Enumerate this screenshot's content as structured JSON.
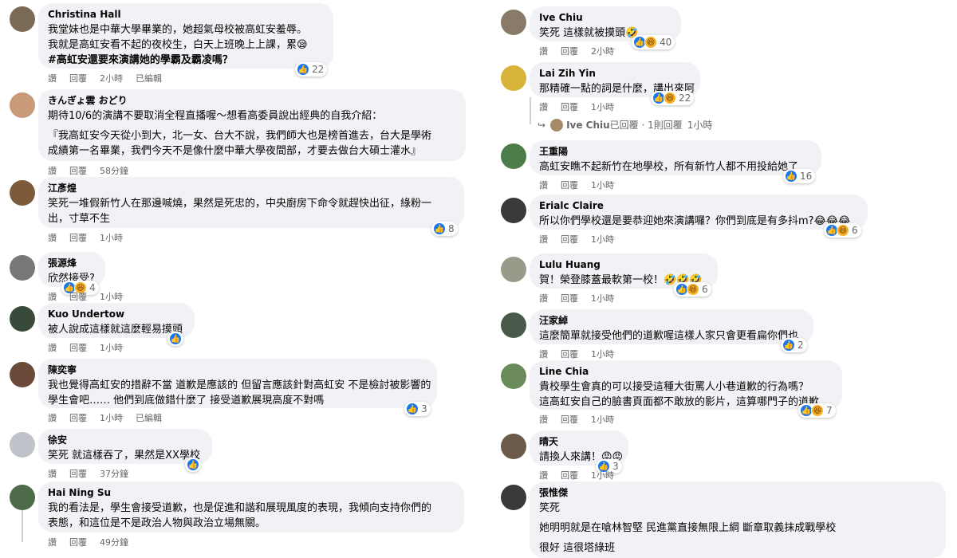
{
  "actions": {
    "like": "讚",
    "reply": "回覆",
    "edited": "已編輯"
  },
  "colors": {
    "bubble": "#f0f2f5",
    "meta_text": "#65676b",
    "like_blue": "#1877f2",
    "haha_yellow": "#f7b125"
  },
  "left": [
    {
      "author": "Christina Hall",
      "lines": [
        "我堂妹也是中華大學畢業的，她超氣母校被高虹安羞辱。",
        "我就是高虹安看不起的夜校生，白天上班晚上上課，累😪",
        "#高虹安還要來演講她的學霸及霸凌嗎？"
      ],
      "time": "2小時",
      "edited": true,
      "reactions": [
        "like"
      ],
      "count": "22"
    },
    {
      "author": "きんぎょ雲 おどり",
      "lines": [
        "期待10/6的演講不要取消全程直播喔～想看高委員說出經典的自我介紹：",
        "『我高虹安今天從小到大，北一女、台大不說，我們師大也是榜首進去，台大是學術",
        "成績第一名畢業，我們今天不是像什麼中華大學夜間部，才要去做台大碩士灌水』"
      ],
      "time": "58分鐘",
      "edited": false,
      "reactions": [],
      "count": ""
    },
    {
      "author": "江彥煌",
      "lines": [
        "笑死一堆假新竹人在那邊喊燒，果然是死忠的，中央廚房下命令就趕快出征，綠粉一",
        "出，寸草不生"
      ],
      "time": "1小時",
      "edited": false,
      "reactions": [
        "like"
      ],
      "count": "8"
    },
    {
      "author": "張源烽",
      "lines": [
        "欣然接受?"
      ],
      "time": "1小時",
      "edited": false,
      "reactions": [
        "like",
        "haha"
      ],
      "count": "4"
    },
    {
      "author": "Kuo Undertow",
      "lines": [
        "被人說成這樣就這麼輕易摸頭"
      ],
      "time": "1小時",
      "edited": false,
      "reactions": [
        "like"
      ],
      "count": ""
    },
    {
      "author": "陳奕寧",
      "lines": [
        "我也覺得高虹安的措辭不當 道歉是應該的 但留言應該針對高虹安 不是檢討被影響的",
        "學生會吧…… 他們到底做錯什麼了 接受道歉展現高度不對嗎"
      ],
      "time": "1小時",
      "edited": true,
      "reactions": [
        "like"
      ],
      "count": "3"
    },
    {
      "author": "徐安",
      "lines": [
        "笑死 就這樣吞了，果然是XX學校"
      ],
      "time": "37分鐘",
      "edited": false,
      "reactions": [
        "like"
      ],
      "count": ""
    },
    {
      "author": "Hai Ning Su",
      "lines": [
        "我的看法是，學生會接受道歉，也是促進和諧和展現風度的表現，我傾向支持你們的",
        "表態，和這位是不是政治人物與政治立場無關。"
      ],
      "time": "49分鐘",
      "edited": false,
      "reactions": [],
      "count": ""
    }
  ],
  "right": [
    {
      "author": "Ive Chiu",
      "lines": [
        "笑死 這樣就被摸頭🤣"
      ],
      "time": "2小時",
      "edited": false,
      "reactions": [
        "like",
        "haha"
      ],
      "count": "40"
    },
    {
      "author": "Lai Zih Yin",
      "lines": [
        "那精確一點的詞是什麼，講出來阿"
      ],
      "time": "1小時",
      "edited": false,
      "reactions": [
        "like",
        "haha"
      ],
      "count": "22"
    },
    {
      "author": "王重陽",
      "lines": [
        "高虹安瞧不起新竹在地學校，所有新竹人都不用投給她了"
      ],
      "time": "1小時",
      "edited": false,
      "reactions": [
        "like"
      ],
      "count": "16"
    },
    {
      "author": "Erialc Claire",
      "lines": [
        "所以你們學校還是要恭迎她來演講囉？你們到底是有多抖m?😂😂😂"
      ],
      "time": "1小時",
      "edited": false,
      "reactions": [
        "like",
        "haha"
      ],
      "count": "6"
    },
    {
      "author": "Lulu Huang",
      "lines": [
        "賀！榮登膝蓋最軟第一校！🤣🤣🤣"
      ],
      "time": "1小時",
      "edited": false,
      "reactions": [
        "like",
        "haha"
      ],
      "count": "6"
    },
    {
      "author": "汪家綽",
      "lines": [
        "這麼簡單就接受他們的道歉喔這樣人家只會更看扁你們也"
      ],
      "time": "1小時",
      "edited": false,
      "reactions": [
        "like"
      ],
      "count": "2"
    },
    {
      "author": "Line Chia",
      "lines": [
        "貴校學生會真的可以接受這種大街罵人小巷道歉的行為嗎？",
        "這高虹安自己的臉書頁面都不敢放的影片，這算哪門子的道歉"
      ],
      "time": "1小時",
      "edited": false,
      "reactions": [
        "like",
        "haha"
      ],
      "count": "7"
    },
    {
      "author": "晴天",
      "lines": [
        "請換人來講！😡😡"
      ],
      "time": "1小時",
      "edited": false,
      "reactions": [
        "like"
      ],
      "count": "3"
    },
    {
      "author": "張惟傑",
      "lines": [
        "笑死",
        "她明明就是在嗆林智堅 民進黨直接無限上綱 斷章取義抹成戰學校",
        "很好 這很塔綠班"
      ],
      "time": "",
      "edited": false,
      "reactions": [],
      "count": ""
    }
  ],
  "reply_summary": {
    "name": "Ive Chiu",
    "text": "已回覆 · 1則回覆",
    "time": "1小時"
  }
}
